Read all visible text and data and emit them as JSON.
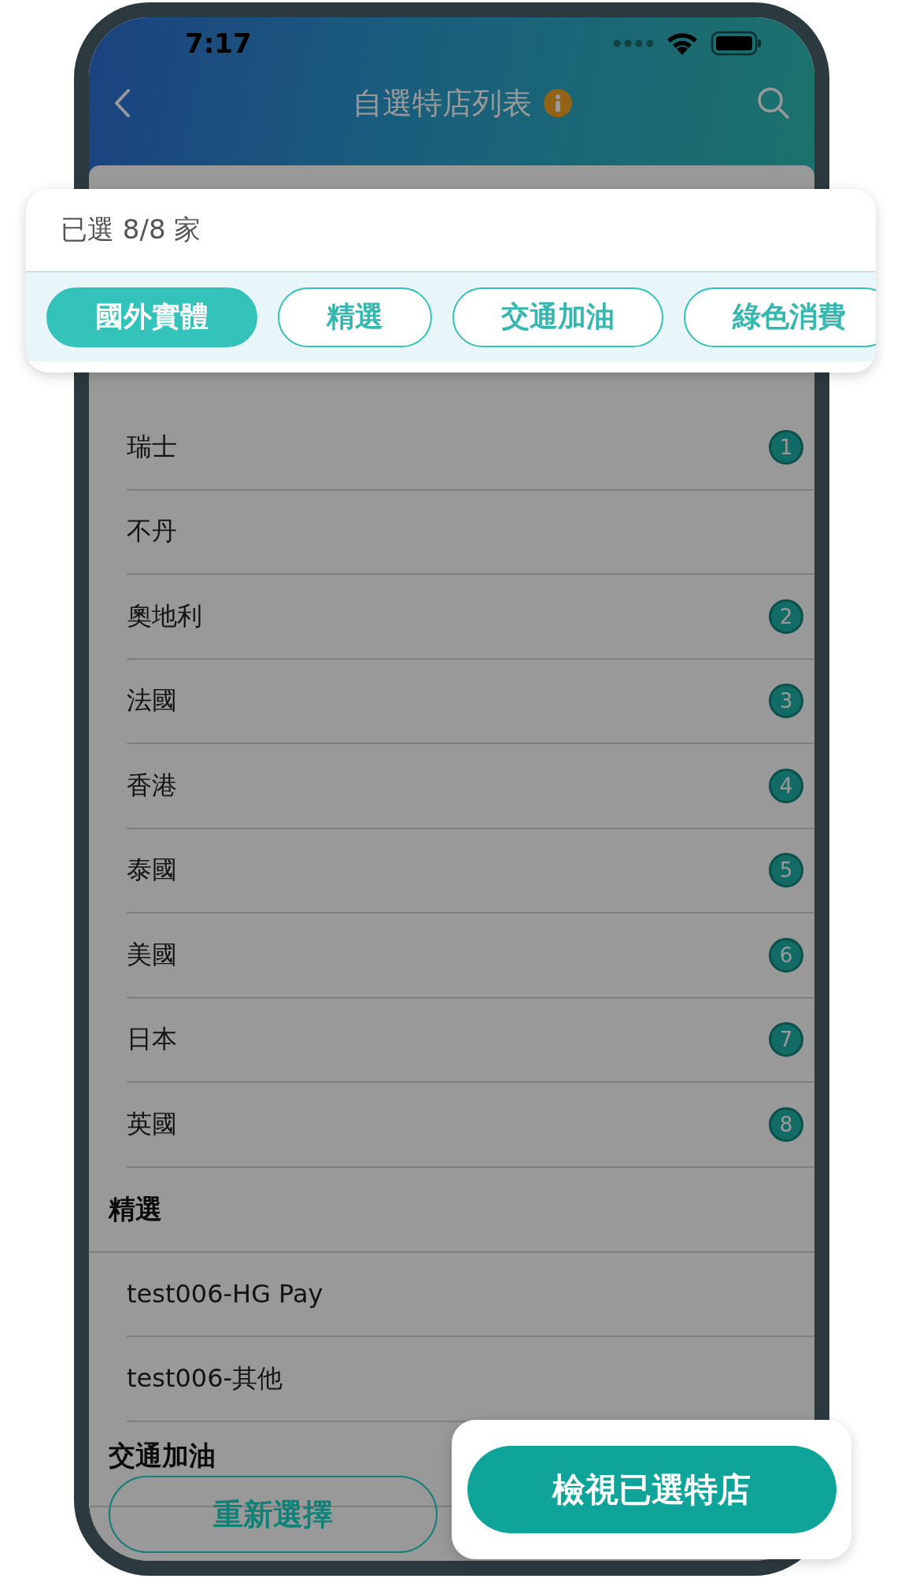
{
  "status_bar": {
    "time": "7:17"
  },
  "nav_bar": {
    "title": "自選特店列表"
  },
  "list": {
    "sections": [
      {
        "items": [
          {
            "name": "瑞士",
            "badge": "1"
          },
          {
            "name": "不丹"
          },
          {
            "name": "奧地利",
            "badge": "2"
          },
          {
            "name": "法國",
            "badge": "3"
          },
          {
            "name": "香港",
            "badge": "4"
          },
          {
            "name": "泰國",
            "badge": "5"
          },
          {
            "name": "美國",
            "badge": "6"
          },
          {
            "name": "日本",
            "badge": "7"
          },
          {
            "name": "英國",
            "badge": "8"
          }
        ]
      },
      {
        "title": "精選",
        "items": [
          {
            "name": "test006-HG Pay"
          },
          {
            "name": "test006-其他"
          }
        ]
      },
      {
        "title": "交通加油"
      }
    ]
  },
  "reset_button": {
    "label": "重新選擇"
  },
  "callouts": {
    "selection": {
      "summary": "已選 8/8 家",
      "chips": [
        {
          "label": "國外實體",
          "selected": true
        },
        {
          "label": "精選",
          "selected": false
        },
        {
          "label": "交通加油",
          "selected": false
        },
        {
          "label": "綠色消費",
          "selected": false
        }
      ]
    },
    "view_button": {
      "label": "檢視已選特店"
    }
  }
}
